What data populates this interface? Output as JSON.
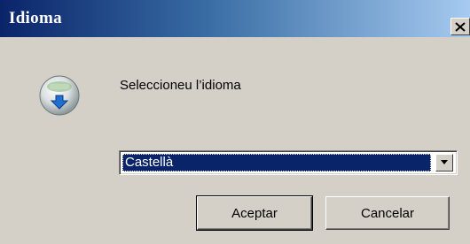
{
  "window": {
    "title": "Idioma"
  },
  "dialog": {
    "prompt": "Seleccioneu l’idioma",
    "language_select": {
      "selected": "Castellà"
    },
    "buttons": {
      "accept": "Aceptar",
      "cancel": "Cancelar"
    }
  },
  "icons": {
    "app": "installer-globe-icon",
    "close": "close-icon",
    "dropdown": "chevron-down-icon"
  },
  "colors": {
    "title_start": "#0a246a",
    "title_end": "#a6caf0",
    "selection": "#0a246a",
    "face": "#d4d0c8"
  }
}
